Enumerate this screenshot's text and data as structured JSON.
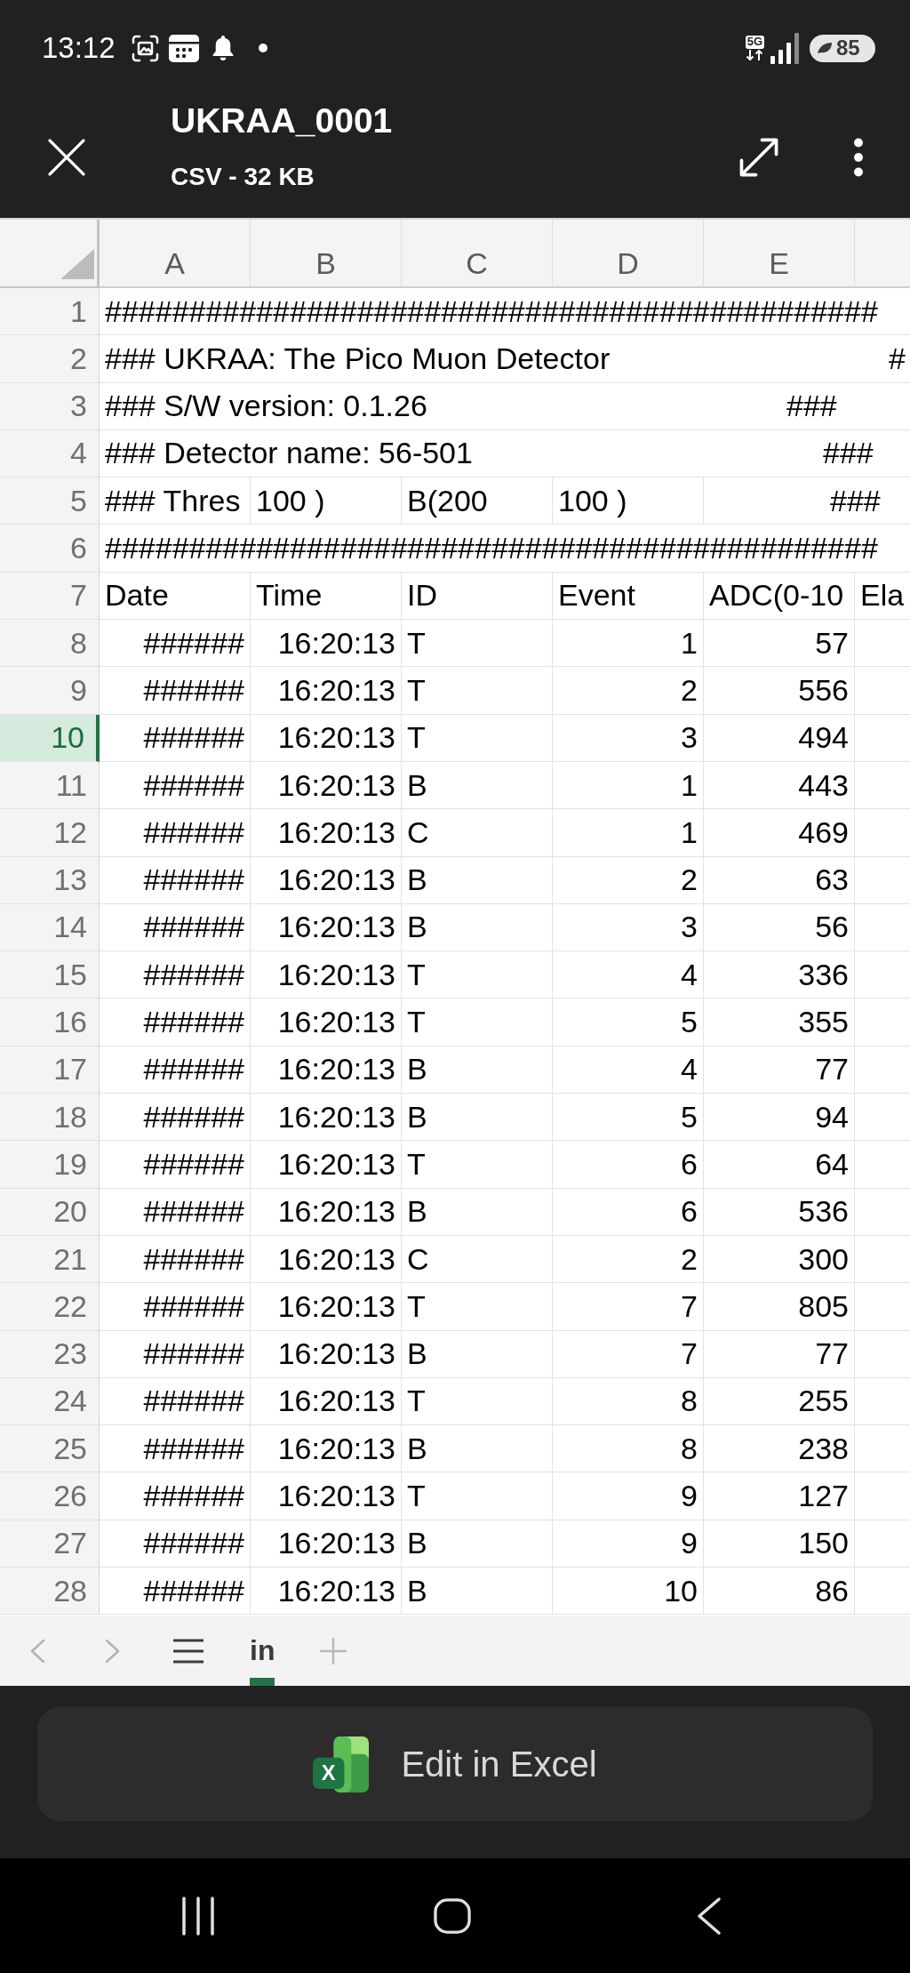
{
  "status_bar": {
    "time": "13:12",
    "network_type": "5G",
    "battery": "85"
  },
  "header": {
    "title": "UKRAA_0001",
    "subtitle": "CSV - 32 KB"
  },
  "sheet": {
    "columns": [
      {
        "label": "A",
        "selected": false
      },
      {
        "label": "B",
        "selected": false
      },
      {
        "label": "C",
        "selected": false
      },
      {
        "label": "D",
        "selected": false
      },
      {
        "label": "E",
        "selected": false
      }
    ],
    "rows": [
      {
        "number": "1",
        "selected": false,
        "kind": "comment",
        "cells": [
          "##############################################"
        ]
      },
      {
        "number": "2",
        "selected": false,
        "kind": "comment",
        "cells": [
          "### UKRAA: The Pico Muon Detector",
          null,
          null,
          null,
          null,
          "#"
        ]
      },
      {
        "number": "3",
        "selected": false,
        "kind": "comment",
        "cells": [
          "### S/W version: 0.1.26",
          null,
          null,
          null,
          "###"
        ]
      },
      {
        "number": "4",
        "selected": false,
        "kind": "comment",
        "cells": [
          "### Detector name: 56-501",
          null,
          null,
          null,
          "###"
        ]
      },
      {
        "number": "5",
        "selected": false,
        "kind": "comment",
        "cells": [
          "### Thres",
          "100 )",
          "B(200",
          "100 )",
          "###"
        ]
      },
      {
        "number": "6",
        "selected": false,
        "kind": "comment",
        "cells": [
          "##############################################"
        ]
      },
      {
        "number": "7",
        "selected": false,
        "kind": "heading",
        "cells": [
          "Date",
          "Time",
          "ID",
          "Event",
          "ADC(0-10",
          "Ela"
        ]
      },
      {
        "number": "8",
        "selected": false,
        "kind": "record",
        "cells": [
          "######",
          "16:20:13",
          "T",
          "1",
          "57"
        ]
      },
      {
        "number": "9",
        "selected": false,
        "kind": "record",
        "cells": [
          "######",
          "16:20:13",
          "T",
          "2",
          "556"
        ]
      },
      {
        "number": "10",
        "selected": true,
        "kind": "record",
        "cells": [
          "######",
          "16:20:13",
          "T",
          "3",
          "494"
        ]
      },
      {
        "number": "11",
        "selected": false,
        "kind": "record",
        "cells": [
          "######",
          "16:20:13",
          "B",
          "1",
          "443"
        ]
      },
      {
        "number": "12",
        "selected": false,
        "kind": "record",
        "cells": [
          "######",
          "16:20:13",
          "C",
          "1",
          "469"
        ]
      },
      {
        "number": "13",
        "selected": false,
        "kind": "record",
        "cells": [
          "######",
          "16:20:13",
          "B",
          "2",
          "63"
        ]
      },
      {
        "number": "14",
        "selected": false,
        "kind": "record",
        "cells": [
          "######",
          "16:20:13",
          "B",
          "3",
          "56"
        ]
      },
      {
        "number": "15",
        "selected": false,
        "kind": "record",
        "cells": [
          "######",
          "16:20:13",
          "T",
          "4",
          "336"
        ]
      },
      {
        "number": "16",
        "selected": false,
        "kind": "record",
        "cells": [
          "######",
          "16:20:13",
          "T",
          "5",
          "355"
        ]
      },
      {
        "number": "17",
        "selected": false,
        "kind": "record",
        "cells": [
          "######",
          "16:20:13",
          "B",
          "4",
          "77"
        ]
      },
      {
        "number": "18",
        "selected": false,
        "kind": "record",
        "cells": [
          "######",
          "16:20:13",
          "B",
          "5",
          "94"
        ]
      },
      {
        "number": "19",
        "selected": false,
        "kind": "record",
        "cells": [
          "######",
          "16:20:13",
          "T",
          "6",
          "64"
        ]
      },
      {
        "number": "20",
        "selected": false,
        "kind": "record",
        "cells": [
          "######",
          "16:20:13",
          "B",
          "6",
          "536"
        ]
      },
      {
        "number": "21",
        "selected": false,
        "kind": "record",
        "cells": [
          "######",
          "16:20:13",
          "C",
          "2",
          "300"
        ]
      },
      {
        "number": "22",
        "selected": false,
        "kind": "record",
        "cells": [
          "######",
          "16:20:13",
          "T",
          "7",
          "805"
        ]
      },
      {
        "number": "23",
        "selected": false,
        "kind": "record",
        "cells": [
          "######",
          "16:20:13",
          "B",
          "7",
          "77"
        ]
      },
      {
        "number": "24",
        "selected": false,
        "kind": "record",
        "cells": [
          "######",
          "16:20:13",
          "T",
          "8",
          "255"
        ]
      },
      {
        "number": "25",
        "selected": false,
        "kind": "record",
        "cells": [
          "######",
          "16:20:13",
          "B",
          "8",
          "238"
        ]
      },
      {
        "number": "26",
        "selected": false,
        "kind": "record",
        "cells": [
          "######",
          "16:20:13",
          "T",
          "9",
          "127"
        ]
      },
      {
        "number": "27",
        "selected": false,
        "kind": "record",
        "cells": [
          "######",
          "16:20:13",
          "B",
          "9",
          "150"
        ]
      },
      {
        "number": "28",
        "selected": false,
        "kind": "record",
        "cells": [
          "######",
          "16:20:13",
          "B",
          "10",
          "86"
        ]
      }
    ]
  },
  "sheet_tabs": [
    {
      "label": "in",
      "selected": true
    }
  ],
  "edit_button": {
    "label": "Edit in Excel",
    "logo_letter": "X"
  }
}
